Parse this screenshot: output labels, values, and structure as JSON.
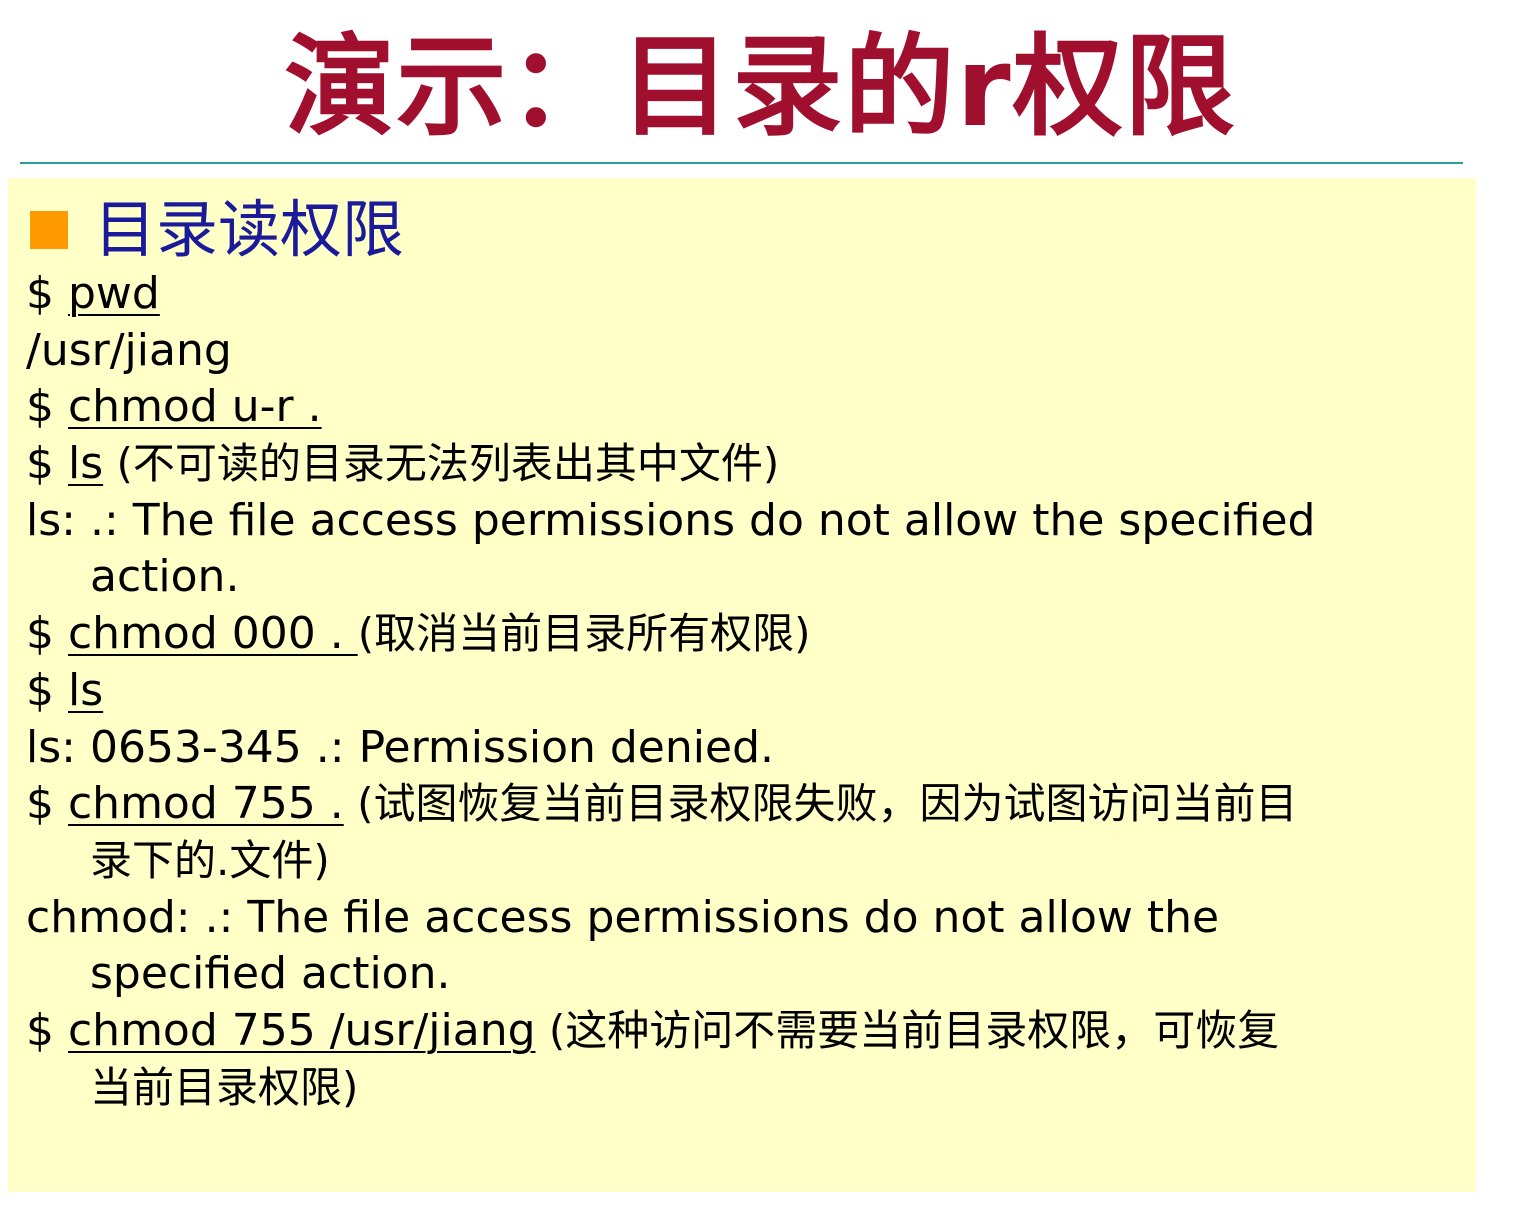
{
  "title": "演示：目录的r权限",
  "section": {
    "heading": "目录读权限",
    "bullet_color": "#ff9900"
  },
  "colors": {
    "title": "#a0102e",
    "heading": "#1a1a9a",
    "box_background": "#ffffc8",
    "rule": "#2e9e98"
  },
  "lines": {
    "l1": {
      "prompt": "$ ",
      "cmd": "pwd"
    },
    "l2": {
      "text": "/usr/jiang"
    },
    "l3": {
      "prompt": "$ ",
      "cmd": "chmod u-r ."
    },
    "l4": {
      "prompt": "$ ",
      "cmd": "ls",
      "note": " (不可读的目录无法列表出其中文件)"
    },
    "l5": {
      "text": "ls: .: The file access permissions do not allow the specified",
      "cont": "action."
    },
    "l6": {
      "prompt": "$ ",
      "cmd": "chmod 000 . ",
      "note": "(取消当前目录所有权限)"
    },
    "l7": {
      "prompt": "$ ",
      "cmd": "ls"
    },
    "l8": {
      "text": "ls: 0653-345 .: Permission denied."
    },
    "l9": {
      "prompt": "$ ",
      "cmd": "chmod 755 .",
      "note": " (试图恢复当前目录权限失败，因为试图访问当前目",
      "cont": "录下的.文件)"
    },
    "l10": {
      "text": "chmod: .: The file access permissions do not allow the",
      "cont": "specified action."
    },
    "l11": {
      "prompt": "$ ",
      "cmd": "chmod 755 /usr/jiang",
      "note": " (这种访问不需要当前目录权限，可恢复",
      "cont": "当前目录权限)"
    }
  }
}
